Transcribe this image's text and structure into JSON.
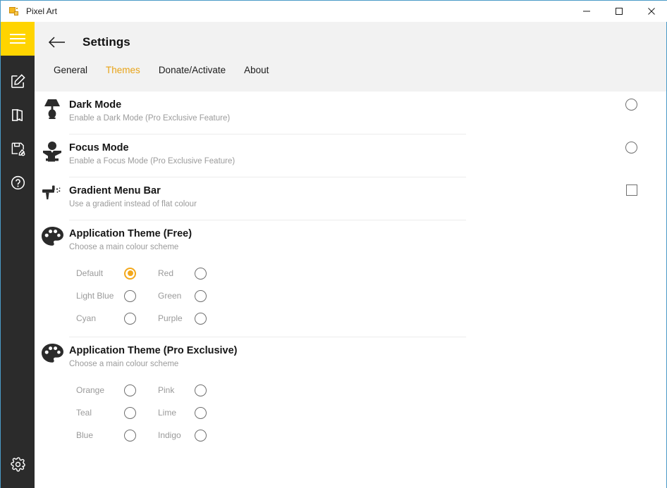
{
  "window": {
    "title": "Pixel Art",
    "app_icon": "pixel-art-icon",
    "controls": {
      "minimize": "minimize-icon",
      "maximize": "maximize-icon",
      "close": "close-icon"
    }
  },
  "sidebar": {
    "menu_toggle": "hamburger-icon",
    "items": [
      {
        "icon": "edit-square-icon",
        "name": "edit"
      },
      {
        "icon": "open-book-icon",
        "name": "book"
      },
      {
        "icon": "save-edit-icon",
        "name": "save-edit"
      },
      {
        "icon": "help-circle-icon",
        "name": "help"
      }
    ],
    "bottom": {
      "icon": "gear-icon",
      "name": "settings"
    }
  },
  "header": {
    "back": "back-arrow-icon",
    "title": "Settings",
    "tabs": [
      {
        "label": "General",
        "active": false
      },
      {
        "label": "Themes",
        "active": true
      },
      {
        "label": "Donate/Activate",
        "active": false
      },
      {
        "label": "About",
        "active": false
      }
    ]
  },
  "settings": {
    "dark_mode": {
      "icon": "lamp-icon",
      "title": "Dark Mode",
      "subtitle": "Enable a Dark Mode (Pro Exclusive Feature)",
      "control": "circle-toggle",
      "checked": false
    },
    "focus_mode": {
      "icon": "person-reading-icon",
      "title": "Focus Mode",
      "subtitle": "Enable a Focus Mode (Pro Exclusive Feature)",
      "control": "circle-toggle",
      "checked": false
    },
    "gradient_menu_bar": {
      "icon": "spray-gun-icon",
      "title": "Gradient Menu Bar",
      "subtitle": "Use a gradient instead of flat colour",
      "control": "checkbox",
      "checked": false
    },
    "theme_free": {
      "icon": "palette-icon",
      "title": "Application Theme (Free)",
      "subtitle": "Choose a main colour scheme",
      "options": [
        {
          "label": "Default",
          "selected": true
        },
        {
          "label": "Red",
          "selected": false
        },
        {
          "label": "Light Blue",
          "selected": false
        },
        {
          "label": "Green",
          "selected": false
        },
        {
          "label": "Cyan",
          "selected": false
        },
        {
          "label": "Purple",
          "selected": false
        }
      ]
    },
    "theme_pro": {
      "icon": "palette-icon",
      "title": "Application Theme (Pro Exclusive)",
      "subtitle": "Choose a main colour scheme",
      "options": [
        {
          "label": "Orange",
          "selected": false
        },
        {
          "label": "Pink",
          "selected": false
        },
        {
          "label": "Teal",
          "selected": false
        },
        {
          "label": "Lime",
          "selected": false
        },
        {
          "label": "Blue",
          "selected": false
        },
        {
          "label": "Indigo",
          "selected": false
        }
      ]
    }
  },
  "colors": {
    "accent_yellow": "#ffd400",
    "accent_orange": "#e8a317",
    "sidebar_dark": "#2b2b2b",
    "header_gray": "#f2f2f2",
    "window_border": "#4a9ac7",
    "radio_selected": "#f3a81c"
  }
}
